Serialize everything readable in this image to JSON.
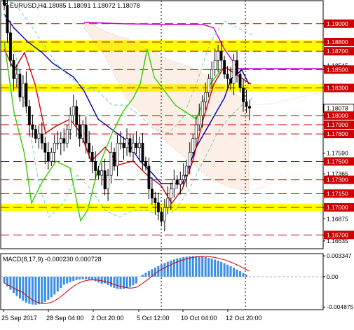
{
  "header": {
    "symbol": "EURUSD,H4",
    "ohlc": "1.18085 1.18091 1.18072 1.18078"
  },
  "price_axis": {
    "min": 1.1655,
    "max": 1.1925,
    "labels": [
      {
        "text": "1.19000",
        "value": 1.19,
        "boxed": true
      },
      {
        "text": "1.18800",
        "value": 1.188,
        "boxed": true
      },
      {
        "text": "1.18700",
        "value": 1.187,
        "boxed": true
      },
      {
        "text": "1.18545",
        "value": 1.18545,
        "boxed": false
      },
      {
        "text": "1.18500",
        "value": 1.185,
        "boxed": true
      },
      {
        "text": "1.18300",
        "value": 1.183,
        "boxed": true
      },
      {
        "text": "1.18078",
        "value": 1.18078,
        "boxed": true,
        "current": true
      },
      {
        "text": "1.18000",
        "value": 1.18,
        "boxed": true
      },
      {
        "text": "1.17900",
        "value": 1.179,
        "boxed": true
      },
      {
        "text": "1.17800",
        "value": 1.178,
        "boxed": true
      },
      {
        "text": "1.17590",
        "value": 1.1759,
        "boxed": false
      },
      {
        "text": "1.17500",
        "value": 1.175,
        "boxed": true
      },
      {
        "text": "1.17365",
        "value": 1.17365,
        "boxed": false
      },
      {
        "text": "1.17300",
        "value": 1.173,
        "boxed": true
      },
      {
        "text": "1.17150",
        "value": 1.1715,
        "boxed": true
      },
      {
        "text": "1.17000",
        "value": 1.17,
        "boxed": true
      },
      {
        "text": "1.16875",
        "value": 1.16875,
        "boxed": false
      },
      {
        "text": "1.16700",
        "value": 1.167,
        "boxed": true
      },
      {
        "text": "1.16635",
        "value": 1.16635,
        "boxed": false
      }
    ]
  },
  "levels": {
    "dashed": [
      1.19,
      1.188,
      1.187,
      1.185,
      1.183,
      1.18,
      1.179,
      1.178,
      1.175,
      1.173,
      1.1715,
      1.17,
      1.167
    ],
    "zones": [
      [
        1.187,
        1.1882
      ],
      [
        1.1826,
        1.1834
      ],
      [
        1.1696,
        1.1704
      ]
    ]
  },
  "time_axis": {
    "labels": [
      "25 Sep 2017",
      "28 Sep 04:00",
      "2 Oct 20:00",
      "5 Oct 12:00",
      "10 Oct 04:00",
      "12 Oct 20:00"
    ]
  },
  "macd": {
    "title": "MACD(8,17,9) -0.000230 0.000728",
    "min": -0.0053,
    "max": 0.0037,
    "labels": [
      {
        "text": "0.003347",
        "value": 0.003347
      },
      {
        "text": "0.00",
        "value": 0
      },
      {
        "text": "-0.004875",
        "value": -0.004875
      }
    ]
  },
  "colors": {
    "zone": "#ffff00",
    "resistance": "#cc0000",
    "candle": "#000000",
    "tenkan": "#cc0000",
    "kijun": "#0000aa",
    "chikou": "#33cc00",
    "senkou_b": "#cc00cc",
    "cloud": "#e8a882",
    "bollinger": "#66ccaa",
    "macd_hist": "#3a8ee6",
    "macd_signal": "#cc0000",
    "cursor": "#000000"
  },
  "chart_data": {
    "type": "line",
    "title": "EURUSD,H4",
    "candles_close": [
      1.192,
      1.189,
      1.186,
      1.184,
      1.1845,
      1.182,
      1.1835,
      1.181,
      1.179,
      1.1785,
      1.1775,
      1.178,
      1.177,
      1.176,
      1.175,
      1.176,
      1.177,
      1.177,
      1.1775,
      1.177,
      1.1785,
      1.18,
      1.181,
      1.179,
      1.1775,
      1.179,
      1.177,
      1.176,
      1.175,
      1.174,
      1.1735,
      1.174,
      1.172,
      1.1735,
      1.176,
      1.1745,
      1.177,
      1.177,
      1.1765,
      1.1775,
      1.176,
      1.177,
      1.1765,
      1.177,
      1.175,
      1.1745,
      1.172,
      1.171,
      1.1705,
      1.1695,
      1.1685,
      1.17,
      1.171,
      1.172,
      1.173,
      1.1725,
      1.173,
      1.1735,
      1.1745,
      1.176,
      1.1775,
      1.179,
      1.18,
      1.1815,
      1.1825,
      1.184,
      1.185,
      1.186,
      1.187,
      1.186,
      1.1845,
      1.184,
      1.1835,
      1.186,
      1.1845,
      1.183,
      1.1815,
      1.181,
      1.1808
    ]
  }
}
